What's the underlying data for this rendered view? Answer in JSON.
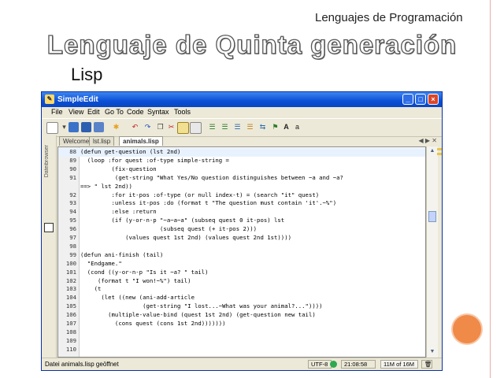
{
  "slide": {
    "header": "Lenguajes de Programación",
    "title": "Lenguaje de Quinta generación",
    "subtitle": "Lisp"
  },
  "window": {
    "title": "SimpleEdit",
    "controls": {
      "minimize": "_",
      "maximize": "□",
      "close": "×"
    }
  },
  "menu": [
    "File",
    "View",
    "Edit",
    "Go To",
    "Code",
    "Syntax",
    "Tools"
  ],
  "tabs": {
    "items": [
      "Welcome",
      "lst.lisp",
      "animals.lisp"
    ],
    "active": "animals.lisp",
    "arrows": "◀ ▶ ✕"
  },
  "side_panel": {
    "label": "Dateibrowser"
  },
  "editor": {
    "lines": [
      {
        "num": "88",
        "text": "(defun get-question (lst 2nd)"
      },
      {
        "num": "89",
        "text": "  (loop :for quest :of-type simple-string ="
      },
      {
        "num": "90",
        "text": "         (fix-question"
      },
      {
        "num": "91",
        "text": "          (get-string \"What Yes/No question distinguishes between ~a and ~a?"
      },
      {
        "num": "",
        "text": "==> \" lst 2nd))"
      },
      {
        "num": "92",
        "text": "         :for it-pos :of-type (or null index-t) = (search \"it\" quest)"
      },
      {
        "num": "93",
        "text": "         :unless it-pos :do (format t \"The question must contain 'it'.~%\")"
      },
      {
        "num": "94",
        "text": "         :else :return"
      },
      {
        "num": "95",
        "text": "         (if (y-or-n-p \"~a~a~a\" (subseq quest 0 it-pos) lst"
      },
      {
        "num": "96",
        "text": "                       (subseq quest (+ it-pos 2)))"
      },
      {
        "num": "97",
        "text": "             (values quest 1st 2nd) (values quest 2nd 1st))))"
      },
      {
        "num": "98",
        "text": ""
      },
      {
        "num": "99",
        "text": "(defun ani-finish (tail)"
      },
      {
        "num": "100",
        "text": "  \"Endgame.\""
      },
      {
        "num": "101",
        "text": "  (cond ((y-or-n-p \"Is it ~a? \" tail)"
      },
      {
        "num": "102",
        "text": "     (format t \"I won!~%\") tail)"
      },
      {
        "num": "103",
        "text": "    (t"
      },
      {
        "num": "104",
        "text": "      (let ((new (ani-add-article"
      },
      {
        "num": "105",
        "text": "                  (get-string \"I lost...~What was your animal?...\"))))"
      },
      {
        "num": "106",
        "text": "        (multiple-value-bind (quest 1st 2nd) (get-question new tail)"
      },
      {
        "num": "107",
        "text": "          (cons quest (cons 1st 2nd)))))))"
      },
      {
        "num": "108",
        "text": ""
      },
      {
        "num": "109",
        "text": ""
      },
      {
        "num": "110",
        "text": ""
      }
    ]
  },
  "statusbar": {
    "message": "Datei animals.lisp geöffnet",
    "encoding": "UTF-8",
    "time": "21:08:58",
    "memory": "11M of 16M",
    "trash_icon": "trash-icon"
  },
  "colors": {
    "titlebar": "#0a4fd6",
    "accent_circle": "#f08a48"
  }
}
